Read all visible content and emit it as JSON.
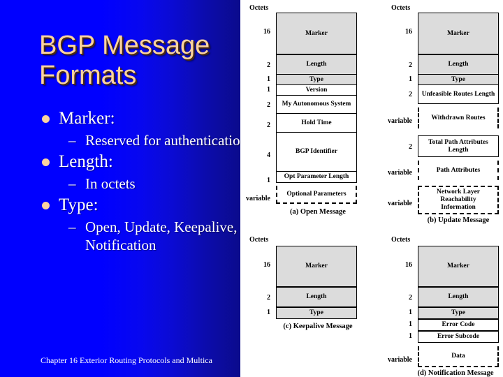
{
  "slide": {
    "title_lines": [
      "BGP Message",
      "Formats"
    ],
    "footer": "Chapter 16 Exterior Routing Protocols and Multica",
    "bullets": [
      {
        "level": 1,
        "text": "Marker:"
      },
      {
        "level": 2,
        "text": "Reserved for authentication"
      },
      {
        "level": 1,
        "text": "Length:"
      },
      {
        "level": 2,
        "text": "In octets"
      },
      {
        "level": 1,
        "text": "Type:"
      },
      {
        "level": 2,
        "text": "Open, Update, Keepalive, Notification"
      }
    ],
    "colors": {
      "background_blue": "#0000ff",
      "background_blue_dark": "#0b0b8c",
      "title_text": "#fbd3a0",
      "bullet_text": "#ffffff",
      "box_shaded": "#dcdcdc"
    }
  },
  "figures": [
    {
      "id": "open-message",
      "caption": "(a) Open Message",
      "octets_header": "Octets",
      "rows": [
        {
          "octets": "16",
          "label": "Marker",
          "style": "shaded"
        },
        {
          "octets": "2",
          "label": "Length",
          "style": "shaded"
        },
        {
          "octets": "1",
          "label": "Type",
          "style": "shaded"
        },
        {
          "octets": "1",
          "label": "Version",
          "style": "solid"
        },
        {
          "octets": "2",
          "label": "My Autonomous System",
          "style": "solid"
        },
        {
          "octets": "2",
          "label": "Hold Time",
          "style": "solid"
        },
        {
          "octets": "4",
          "label": "BGP Identifier",
          "style": "solid"
        },
        {
          "octets": "1",
          "label": "Opt Parameter Length",
          "style": "solid"
        },
        {
          "octets": "variable",
          "label": "Optional Parameters",
          "style": "dashed"
        }
      ]
    },
    {
      "id": "update-message",
      "caption": "(b) Update Message",
      "octets_header": "Octets",
      "rows": [
        {
          "octets": "16",
          "label": "Marker",
          "style": "shaded"
        },
        {
          "octets": "2",
          "label": "Length",
          "style": "shaded"
        },
        {
          "octets": "1",
          "label": "Type",
          "style": "shaded"
        },
        {
          "octets": "2",
          "label": "Unfeasible Routes Length",
          "style": "solid"
        },
        {
          "octets": "variable",
          "label": "Withdrawn Routes",
          "style": "dashed"
        },
        {
          "octets": "2",
          "label": "Total Path Attributes Length",
          "style": "solid"
        },
        {
          "octets": "variable",
          "label": "Path Attributes",
          "style": "dashed"
        },
        {
          "octets": "variable",
          "label": "Network Layer Reachability Information",
          "style": "dashed"
        }
      ]
    },
    {
      "id": "keepalive-message",
      "caption": "(c) Keepalive Message",
      "octets_header": "Octets",
      "rows": [
        {
          "octets": "16",
          "label": "Marker",
          "style": "shaded"
        },
        {
          "octets": "2",
          "label": "Length",
          "style": "shaded"
        },
        {
          "octets": "1",
          "label": "Type",
          "style": "shaded"
        }
      ]
    },
    {
      "id": "notification-message",
      "caption": "(d) Notification Message",
      "octets_header": "Octets",
      "rows": [
        {
          "octets": "16",
          "label": "Marker",
          "style": "shaded"
        },
        {
          "octets": "2",
          "label": "Length",
          "style": "shaded"
        },
        {
          "octets": "1",
          "label": "Type",
          "style": "shaded"
        },
        {
          "octets": "1",
          "label": "Error Code",
          "style": "solid"
        },
        {
          "octets": "1",
          "label": "Error Subcode",
          "style": "solid"
        },
        {
          "octets": "variable",
          "label": "Data",
          "style": "dashed"
        }
      ]
    }
  ]
}
